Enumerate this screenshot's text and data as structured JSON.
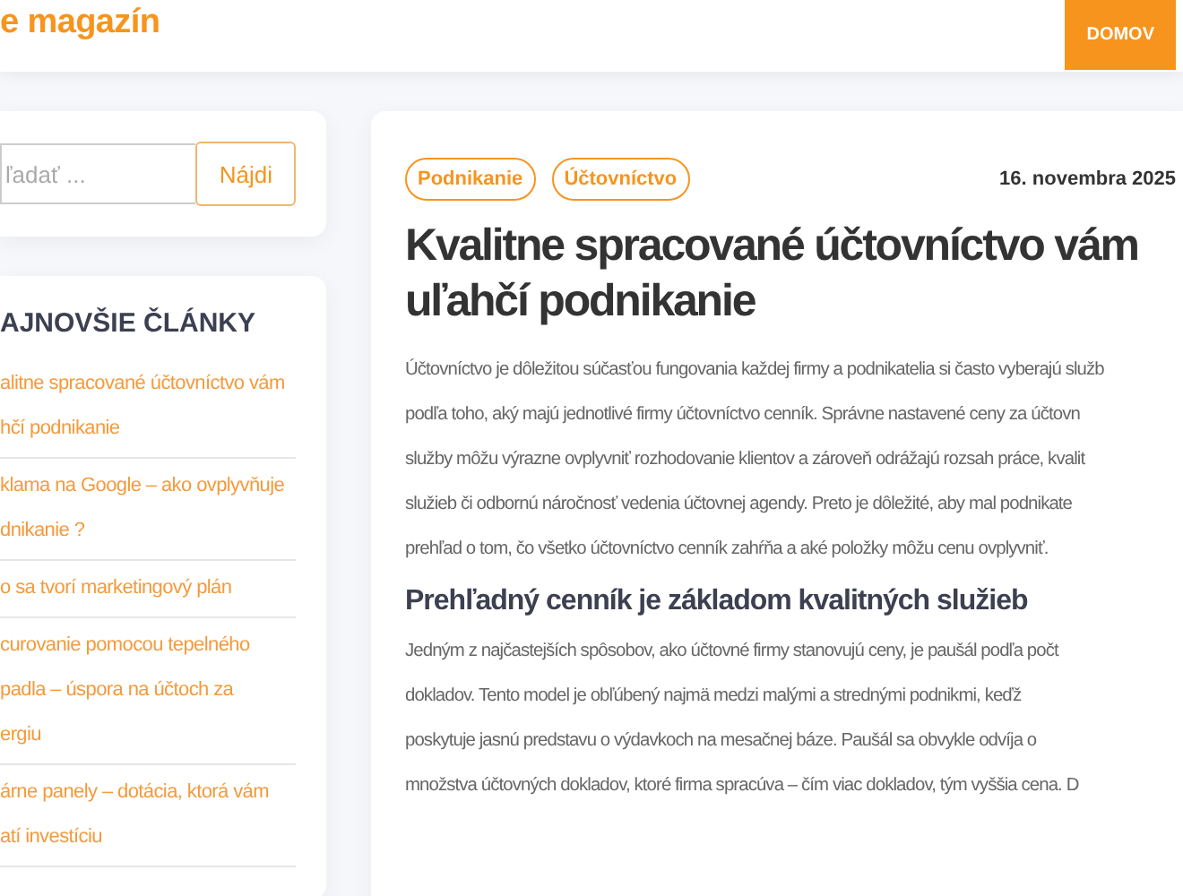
{
  "header": {
    "brand": "e magazín",
    "nav": [
      {
        "label": "DOMOV",
        "selected": true
      }
    ]
  },
  "search": {
    "placeholder": "ľadať ...",
    "button": "Nájdi"
  },
  "latest": {
    "title": "AJNOVŠIE ČLÁNKY",
    "items": [
      {
        "lines": [
          "alitne spracované účtovníctvo vám",
          "hčí podnikanie"
        ]
      },
      {
        "lines": [
          "klama na Google – ako ovplyvňuje",
          "dnikanie ?"
        ]
      },
      {
        "lines": [
          "o sa tvorí marketingový plán"
        ]
      },
      {
        "lines": [
          "curovanie pomocou tepelného",
          "padla – úspora na účtoch za",
          "ergiu"
        ]
      },
      {
        "lines": [
          "árne panely – dotácia, ktorá vám",
          "atí investíciu"
        ]
      }
    ]
  },
  "article": {
    "tags": [
      "Podnikanie",
      "Účtovníctvo"
    ],
    "date": "16. novembra 2025",
    "title": "Kvalitne spracované účtovníctvo vám uľahčí podnikanie",
    "blocks": [
      {
        "kind": "paragraph",
        "lines": [
          "Účtovníctvo je dôležitou súčasťou fungovania každej firmy a podnikatelia si často vyberajú služb",
          "podľa toho, aký majú jednotlivé firmy účtovníctvo cenník. Správne nastavené ceny za účtovn",
          "služby môžu výrazne ovplyvniť rozhodovanie klientov a zároveň odrážajú rozsah práce, kvalit",
          "služieb či odbornú náročnosť vedenia účtovnej agendy. Preto je dôležité, aby mal podnikate",
          "prehľad o tom, čo všetko účtovníctvo cenník zahŕňa a aké položky môžu cenu ovplyvniť."
        ]
      },
      {
        "kind": "heading",
        "lines": [
          "Prehľadný cenník je základom kvalitných služieb"
        ]
      },
      {
        "kind": "paragraph",
        "lines": [
          "Jedným z najčastejších spôsobov, ako účtovné firmy stanovujú ceny, je paušál podľa počt",
          "dokladov. Tento model je obľúbený najmä medzi malými a strednými podnikmi, keďž",
          "poskytuje jasnú predstavu o výdavkoch na mesačnej báze. Paušál sa obvykle odvíja o",
          "množstva účtovných dokladov, ktoré firma spracúva – čím viac dokladov, tým vyššia cena. D"
        ]
      }
    ]
  }
}
